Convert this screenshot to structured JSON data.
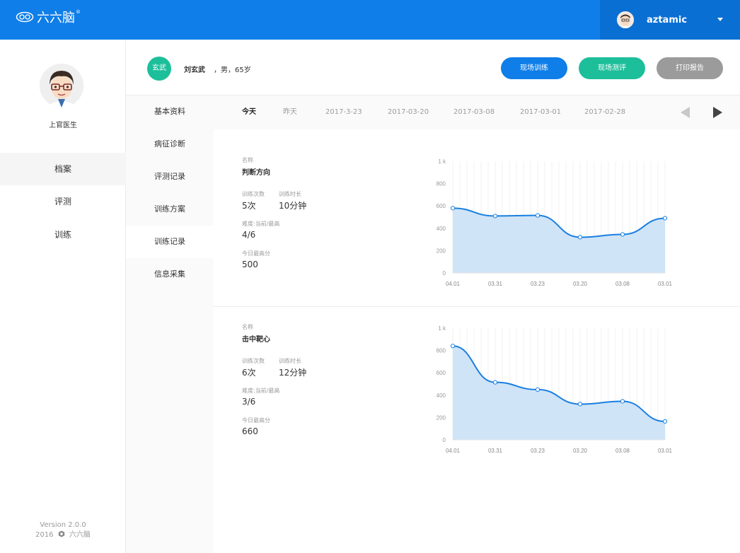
{
  "app": {
    "logo_text": "六六脑",
    "brand_color": "#0f7ee8"
  },
  "user": {
    "name": "aztamic"
  },
  "sidebar": {
    "doctor_name": "上官医生",
    "items": [
      {
        "label": "档案"
      },
      {
        "label": "评测"
      },
      {
        "label": "训练"
      }
    ],
    "version": "Version 2.0.0",
    "copyright_year": "2016",
    "copyright_name": "六六脑"
  },
  "patient": {
    "badge": "玄武",
    "name": "刘玄武",
    "info": "，男，65岁"
  },
  "actions": {
    "onsite_training": "现场训练",
    "onsite_eval": "现场测评",
    "print_report": "打印报告"
  },
  "subnav": {
    "items": [
      {
        "label": "基本资料"
      },
      {
        "label": "病征诊断"
      },
      {
        "label": "评测记录"
      },
      {
        "label": "训练方案"
      },
      {
        "label": "训练记录"
      },
      {
        "label": "信息采集"
      }
    ]
  },
  "date_tabs": [
    {
      "label": "今天"
    },
    {
      "label": "昨天"
    },
    {
      "label": "2017-3-23"
    },
    {
      "label": "2017-03-20"
    },
    {
      "label": "2017-03-08"
    },
    {
      "label": "2017-03-01"
    },
    {
      "label": "2017-02-28"
    }
  ],
  "records": [
    {
      "name_label": "名称",
      "name": "判断方向",
      "count_label": "训练次数",
      "count": "5次",
      "duration_label": "训练时长",
      "duration": "10分钟",
      "difficulty_label": "难度:当前/最高",
      "difficulty": "4/6",
      "best_label": "今日最高分",
      "best": "500"
    },
    {
      "name_label": "名称",
      "name": "击中靶心",
      "count_label": "训练次数",
      "count": "6次",
      "duration_label": "训练时长",
      "duration": "12分钟",
      "difficulty_label": "难度:当前/最高",
      "difficulty": "3/6",
      "best_label": "今日最高分",
      "best": "660"
    }
  ],
  "chart_data": [
    {
      "type": "area",
      "x": [
        "04.01",
        "03.31",
        "03.23",
        "03.20",
        "03.08",
        "03.01"
      ],
      "y_tick_labels": [
        "0",
        "200",
        "400",
        "600",
        "800",
        "1 k"
      ],
      "ylim": [
        0,
        1000
      ],
      "values": [
        580,
        510,
        515,
        320,
        345,
        490
      ],
      "line_color": "#1a7fe0",
      "fill_color": "#cce3f7"
    },
    {
      "type": "area",
      "x": [
        "04.01",
        "03.31",
        "03.23",
        "03.20",
        "03.08",
        "03.01"
      ],
      "y_tick_labels": [
        "0",
        "200",
        "400",
        "600",
        "800",
        "1 k"
      ],
      "ylim": [
        0,
        1000
      ],
      "values": [
        840,
        515,
        450,
        320,
        345,
        165
      ],
      "line_color": "#1a7fe0",
      "fill_color": "#cce3f7"
    }
  ]
}
